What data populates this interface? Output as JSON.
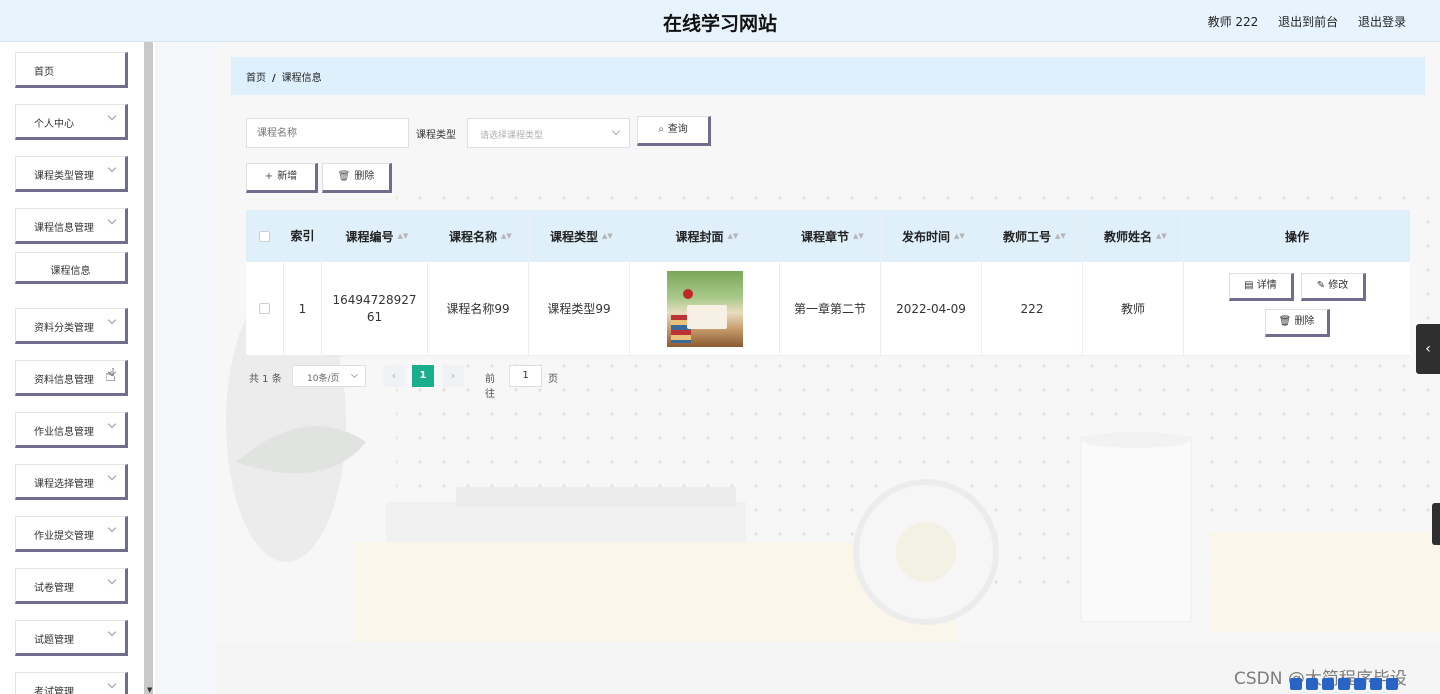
{
  "header": {
    "site_title": "在线学习网站",
    "user": "教师 222",
    "exit_front": "退出到前台",
    "logout": "退出登录"
  },
  "sidebar": {
    "items": [
      {
        "label": "首页",
        "has_children": false
      },
      {
        "label": "个人中心",
        "has_children": true
      },
      {
        "label": "课程类型管理",
        "has_children": true
      },
      {
        "label": "课程信息管理",
        "has_children": true
      },
      {
        "label": "课程信息",
        "sub": true
      },
      {
        "label": "资料分类管理",
        "has_children": true
      },
      {
        "label": "资料信息管理",
        "has_children": true
      },
      {
        "label": "作业信息管理",
        "has_children": true
      },
      {
        "label": "课程选择管理",
        "has_children": true
      },
      {
        "label": "作业提交管理",
        "has_children": true
      },
      {
        "label": "试卷管理",
        "has_children": true
      },
      {
        "label": "试题管理",
        "has_children": true
      },
      {
        "label": "考试管理",
        "has_children": true
      }
    ]
  },
  "breadcrumb": {
    "home": "首页",
    "separator": "/",
    "current": "课程信息"
  },
  "search": {
    "name_placeholder": "课程名称",
    "type_label": "课程类型",
    "type_placeholder": "请选择课程类型",
    "query_button": "查询",
    "query_icon": "search-icon"
  },
  "actions": {
    "add": "新增",
    "add_icon": "plus-icon",
    "delete": "删除",
    "delete_icon": "trash-icon"
  },
  "table": {
    "columns": [
      "",
      "索引",
      "课程编号",
      "课程名称",
      "课程类型",
      "课程封面",
      "课程章节",
      "发布时间",
      "教师工号",
      "教师姓名",
      "操作"
    ],
    "sortable": [
      false,
      false,
      true,
      true,
      true,
      true,
      true,
      true,
      true,
      true,
      false
    ],
    "rows": [
      {
        "index": "1",
        "course_no": "1649472892761",
        "course_name": "课程名称99",
        "course_type": "课程类型99",
        "cover": "book-cover-image",
        "chapter": "第一章第二节",
        "publish_date": "2022-04-09",
        "teacher_id": "222",
        "teacher_name": "教师"
      }
    ],
    "row_actions": {
      "detail": "详情",
      "edit": "修改",
      "delete": "删除"
    }
  },
  "pagination": {
    "total": "共 1 条",
    "page_size": "10条/页",
    "current_page": "1",
    "goto_label": "前往",
    "goto_value": "1",
    "goto_unit": "页"
  },
  "watermark": "CSDN @太简程序毕设",
  "colors": {
    "header_bg": "#e8f4fd",
    "breadcrumb_bg": "#ddf0fc",
    "table_header_bg": "#dff0fb",
    "button_shadow": "#6f6e8e",
    "active_page": "#1bae8d"
  }
}
